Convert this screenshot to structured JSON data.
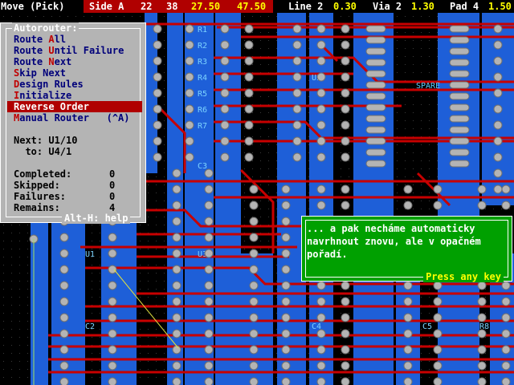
{
  "statusbar": {
    "mode": "Move (Pick)",
    "side_label": "Side A",
    "coord_1": "22",
    "coord_2": "38",
    "coord_3": "27.50",
    "coord_4": "47.50",
    "line_label": "Line 2",
    "line_value": "0.30",
    "via_label": "Via 2",
    "via_value": "1.30",
    "pad_label": "Pad 4",
    "pad_value": "1.50"
  },
  "menu": {
    "title": "Autorouter:",
    "items": [
      {
        "hotkey": "",
        "prefix": "Route ",
        "key": "A",
        "rest": "ll"
      },
      {
        "prefix": "Route ",
        "key": "U",
        "rest": "ntil Failure"
      },
      {
        "prefix": "Route ",
        "key": "N",
        "rest": "ext"
      },
      {
        "prefix": "",
        "key": "S",
        "rest": "kip Next"
      },
      {
        "prefix": "",
        "key": "D",
        "rest": "esign Rules"
      },
      {
        "prefix": "",
        "key": "I",
        "rest": "nitialize"
      },
      {
        "prefix": "",
        "key": "R",
        "rest": "everse Order"
      },
      {
        "prefix": "",
        "key": "M",
        "rest": "anual Router   (^A)"
      }
    ],
    "next_label": "Next: U1/10",
    "to_label": "  to: U4/1",
    "stats": [
      {
        "label": "Completed:",
        "value": "0"
      },
      {
        "label": "Skipped:",
        "value": "0"
      },
      {
        "label": "Failures:",
        "value": "0"
      },
      {
        "label": "Remains:",
        "value": "4"
      }
    ],
    "help": "Alt-H: help"
  },
  "dialog": {
    "line1": "... a pak necháme automaticky",
    "line2": "navrhnout znovu, ale v opačném",
    "line3": "pořadí.",
    "press": "Press any key"
  },
  "pcb": {
    "labels": [
      "R1",
      "R2",
      "R3",
      "R4",
      "R5",
      "R6",
      "R7",
      "U5",
      "SPARE",
      "C3",
      "U1",
      "U3",
      "C2",
      "C4",
      "C5",
      "R8"
    ]
  },
  "colors": {
    "board": "#000000",
    "copper_blue": "#1e5fd8",
    "copper_red": "#c80000",
    "pad_gray": "#b4b4b4",
    "menu_bg": "#b4b4b4",
    "menu_select": "#b00000",
    "dialog_bg": "#00a000",
    "status_accent": "#ffff00"
  }
}
